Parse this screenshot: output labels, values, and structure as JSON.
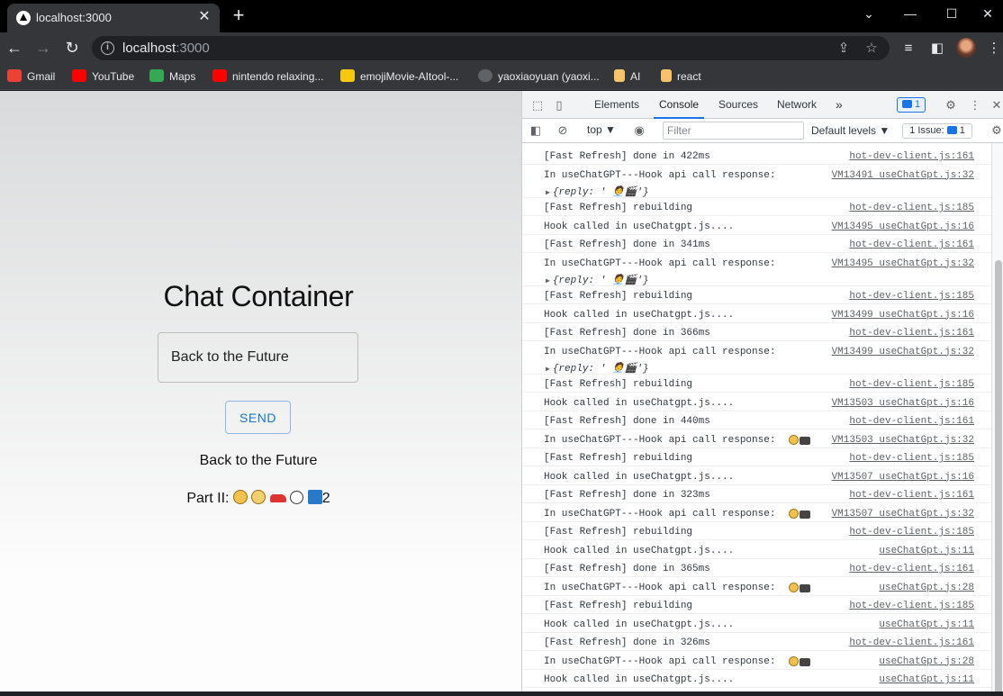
{
  "browser": {
    "tab_title": "localhost:3000",
    "tab_close": "✕",
    "new_tab": "+",
    "url_host": "localhost",
    "url_port": ":3000"
  },
  "bookmarks": [
    {
      "label": "Gmail",
      "color": "#ea4335"
    },
    {
      "label": "YouTube",
      "color": "#ff0000"
    },
    {
      "label": "Maps",
      "color": "#34a853"
    },
    {
      "label": "nintendo relaxing...",
      "color": "#ff0000"
    },
    {
      "label": "emojiMovie-AItool-...",
      "color": "#f6c90e"
    },
    {
      "label": "yaoxiaoyuan (yaoxi...",
      "color": "#bdc1c6"
    },
    {
      "label": "AI",
      "color": "#f6c26b"
    },
    {
      "label": "react",
      "color": "#f6c26b"
    }
  ],
  "page": {
    "title": "Chat Container",
    "input_value": "Back to the Future",
    "send_label": "SEND",
    "reply_line1": "Back to the Future",
    "reply_line2_prefix": "Part II:",
    "reply_line2_suffix": "2"
  },
  "devtools": {
    "tabs": [
      "Elements",
      "Console",
      "Sources",
      "Network"
    ],
    "active_tab": "Console",
    "more_tabs": "»",
    "msg_count": "1",
    "context": "top ▼",
    "filter_placeholder": "Filter",
    "levels": "Default levels ▼",
    "issues_label": "1 Issue:",
    "issues_count": "1",
    "rows": [
      {
        "msg": "[Fast Refresh] done in 422ms",
        "src": "hot-dev-client.js:161"
      },
      {
        "msg": "In useChatGPT---Hook api call response:",
        "src": "VM13491 useChatGpt.js:32",
        "obj": "{reply: ' 🧑‍💼🎬'}"
      },
      {
        "msg": "[Fast Refresh] rebuilding",
        "src": "hot-dev-client.js:185"
      },
      {
        "msg": "Hook called in useChatgpt.js....",
        "src": "VM13495 useChatGpt.js:16"
      },
      {
        "msg": "[Fast Refresh] done in 341ms",
        "src": "hot-dev-client.js:161"
      },
      {
        "msg": "In useChatGPT---Hook api call response:",
        "src": "VM13495 useChatGpt.js:32",
        "obj": "{reply: ' 🧑‍💼🎬'}"
      },
      {
        "msg": "[Fast Refresh] rebuilding",
        "src": "hot-dev-client.js:185"
      },
      {
        "msg": "Hook called in useChatgpt.js....",
        "src": "VM13499 useChatGpt.js:16"
      },
      {
        "msg": "[Fast Refresh] done in 366ms",
        "src": "hot-dev-client.js:161"
      },
      {
        "msg": "In useChatGPT---Hook api call response:",
        "src": "VM13499 useChatGpt.js:32",
        "obj": "{reply: ' 🧑‍💼🎬'}"
      },
      {
        "msg": "[Fast Refresh] rebuilding",
        "src": "hot-dev-client.js:185"
      },
      {
        "msg": "Hook called in useChatgpt.js....",
        "src": "VM13503 useChatGpt.js:16"
      },
      {
        "msg": "[Fast Refresh] done in 440ms",
        "src": "hot-dev-client.js:161"
      },
      {
        "msg": "In useChatGPT---Hook api call response:",
        "src": "VM13503 useChatGpt.js:32",
        "emoji": true
      },
      {
        "msg": "[Fast Refresh] rebuilding",
        "src": "hot-dev-client.js:185"
      },
      {
        "msg": "Hook called in useChatgpt.js....",
        "src": "VM13507 useChatGpt.js:16"
      },
      {
        "msg": "[Fast Refresh] done in 323ms",
        "src": "hot-dev-client.js:161"
      },
      {
        "msg": "In useChatGPT---Hook api call response:",
        "src": "VM13507 useChatGpt.js:32",
        "emoji": true
      },
      {
        "msg": "[Fast Refresh] rebuilding",
        "src": "hot-dev-client.js:185"
      },
      {
        "msg": "Hook called in useChatgpt.js....",
        "src": "useChatGpt.js:11"
      },
      {
        "msg": "[Fast Refresh] done in 365ms",
        "src": "hot-dev-client.js:161"
      },
      {
        "msg": "In useChatGPT---Hook api call response:",
        "src": "useChatGpt.js:28",
        "emoji": true
      },
      {
        "msg": "[Fast Refresh] rebuilding",
        "src": "hot-dev-client.js:185"
      },
      {
        "msg": "Hook called in useChatgpt.js....",
        "src": "useChatGpt.js:11"
      },
      {
        "msg": "[Fast Refresh] done in 326ms",
        "src": "hot-dev-client.js:161"
      },
      {
        "msg": "In useChatGPT---Hook api call response:",
        "src": "useChatGpt.js:28",
        "emoji": true
      },
      {
        "msg": "Hook called in useChatgpt.js....",
        "src": "useChatGpt.js:11"
      }
    ]
  }
}
